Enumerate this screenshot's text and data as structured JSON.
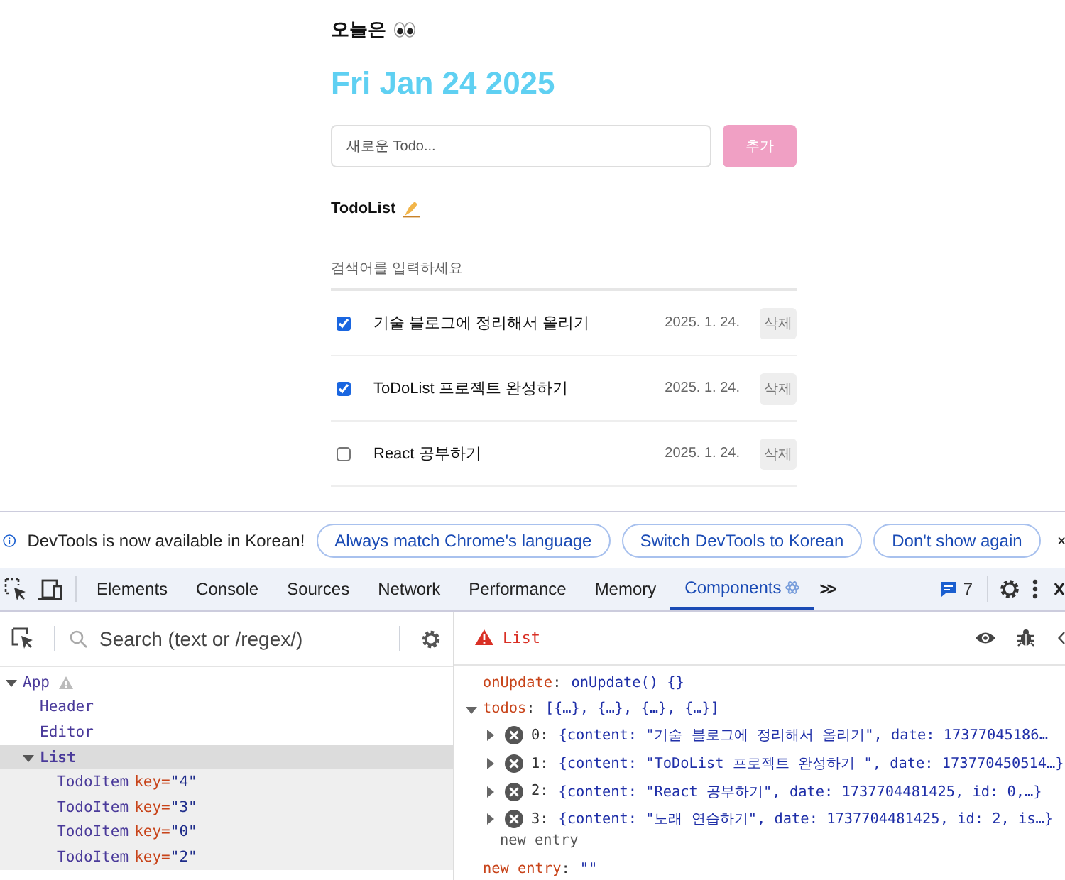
{
  "app": {
    "greeting": "오늘은",
    "date": "Fri Jan 24 2025",
    "new_todo": {
      "placeholder": "새로운 Todo..."
    },
    "add_button": "추가",
    "list_title": "TodoList",
    "search": {
      "placeholder": "검색어를 입력하세요"
    },
    "todos": [
      {
        "content": "기술 블로그에 정리해서 올리기",
        "date": "2025. 1. 24.",
        "checked": true,
        "delete_label": "삭제"
      },
      {
        "content": "ToDoList 프로젝트 완성하기",
        "date": "2025. 1. 24.",
        "checked": true,
        "delete_label": "삭제"
      },
      {
        "content": "React 공부하기",
        "date": "2025. 1. 24.",
        "checked": false,
        "delete_label": "삭제"
      }
    ]
  },
  "devtools": {
    "infobar": {
      "message": "DevTools is now available in Korean!",
      "buttons": [
        "Always match Chrome's language",
        "Switch DevTools to Korean",
        "Don't show again"
      ]
    },
    "tabs": [
      {
        "label": "Elements",
        "selected": false
      },
      {
        "label": "Console",
        "selected": false
      },
      {
        "label": "Sources",
        "selected": false
      },
      {
        "label": "Network",
        "selected": false
      },
      {
        "label": "Performance",
        "selected": false
      },
      {
        "label": "Memory",
        "selected": false
      },
      {
        "label": "Components",
        "selected": true
      }
    ],
    "more_tabs": ">>",
    "message_count": "7",
    "components": {
      "search": {
        "placeholder": "Search (text or /regex/)"
      },
      "tree": [
        {
          "name": "App",
          "selected": false,
          "warning": true,
          "expanded": true,
          "children": [
            {
              "name": "Header",
              "selected": false,
              "warning": false
            },
            {
              "name": "Editor",
              "selected": false,
              "warning": false
            },
            {
              "name": "List",
              "selected": true,
              "warning": false,
              "expanded": true,
              "children": [
                {
                  "name": "TodoItem",
                  "key_label": "key=",
                  "key": "\"4\"",
                  "selected": false,
                  "warning": false
                },
                {
                  "name": "TodoItem",
                  "key_label": "key=",
                  "key": "\"3\"",
                  "selected": false,
                  "warning": false
                },
                {
                  "name": "TodoItem",
                  "key_label": "key=",
                  "key": "\"0\"",
                  "selected": false,
                  "warning": false
                },
                {
                  "name": "TodoItem",
                  "key_label": "key=",
                  "key": "\"2\"",
                  "selected": false,
                  "warning": false
                }
              ]
            }
          ]
        }
      ],
      "inspector": {
        "title": "List",
        "props": [
          {
            "kind": "function",
            "key": "onUpdate",
            "separator": ":",
            "value": "onUpdate() {}"
          },
          {
            "kind": "array",
            "key": "todos",
            "separator": ":",
            "summary": "[{…}, {…}, {…}, {…}]",
            "expanded": true,
            "items": [
              {
                "index": "0:",
                "value": "{content: \"기술 블로그에 정리해서 올리기\", date: 17377045186…"
              },
              {
                "index": "1:",
                "value": "{content: \"ToDoList 프로젝트 완성하기 \", date: 173770450514…}"
              },
              {
                "index": "2:",
                "value": "{content: \"React 공부하기\", date: 1737704481425, id: 0,…}"
              },
              {
                "index": "3:",
                "value": "{content: \"노래 연습하기\", date: 1737704481425, id: 2, is…}"
              }
            ],
            "new_entry": "new entry"
          },
          {
            "kind": "string",
            "key": "new entry",
            "separator": ":",
            "value": "\"\""
          }
        ]
      }
    }
  }
}
